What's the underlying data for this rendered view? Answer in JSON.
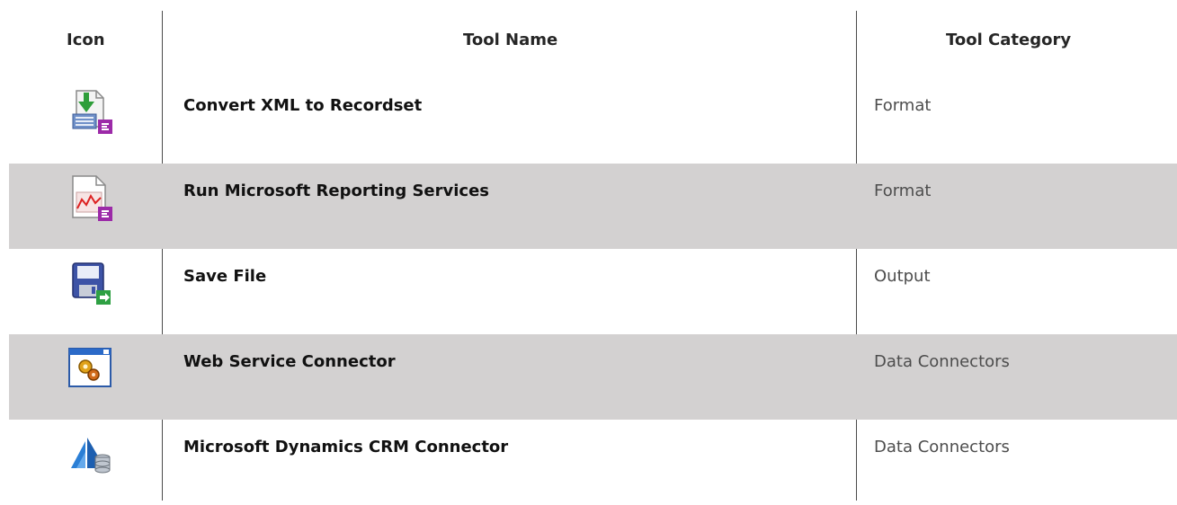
{
  "headers": {
    "icon": "Icon",
    "name": "Tool Name",
    "category": "Tool Category"
  },
  "rows": [
    {
      "icon": "convert-xml-icon",
      "name": "Convert XML to Recordset",
      "category": "Format",
      "shaded": false
    },
    {
      "icon": "reporting-services-icon",
      "name": "Run Microsoft Reporting Services",
      "category": "Format",
      "shaded": true
    },
    {
      "icon": "save-file-icon",
      "name": "Save File",
      "category": "Output",
      "shaded": false
    },
    {
      "icon": "web-service-icon",
      "name": "Web Service Connector",
      "category": "Data Connectors",
      "shaded": true
    },
    {
      "icon": "dynamics-crm-icon",
      "name": "Microsoft Dynamics CRM Connector",
      "category": "Data Connectors",
      "shaded": false
    }
  ],
  "colors": {
    "shade": "#d3d1d1",
    "category_text": "#4d4d4d",
    "rule": "#4a4a4a"
  }
}
